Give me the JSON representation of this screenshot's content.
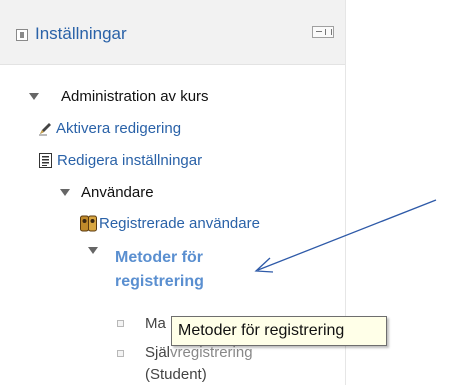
{
  "header": {
    "title": "Inställningar"
  },
  "tree": {
    "root": "Administration av kurs",
    "enable_editing": "Aktivera redigering",
    "edit_settings": "Redigera inställningar",
    "users": "Användare",
    "enrolled_users": "Registrerade användare",
    "enrolment_methods_line1": "Metoder för",
    "enrolment_methods_line2": "registrering",
    "manual_partial": "Ma",
    "self_partial": "Själ",
    "self_obscured": "vregistrering",
    "student": "(Student)"
  },
  "tooltip": {
    "text": "Metoder för registrering"
  },
  "colors": {
    "link": "#2a62a8",
    "active_link": "#5a8fd0",
    "arrow": "#2e5aa8",
    "header_bg": "#f2f2f2"
  }
}
